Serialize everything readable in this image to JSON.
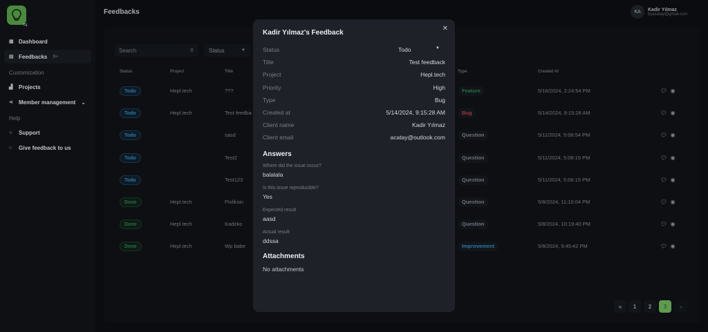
{
  "sidebar": {
    "items": [
      {
        "label": "Dashboard",
        "icon": "grid-icon"
      },
      {
        "label": "Feedbacks",
        "icon": "inbox-icon",
        "badge": "9+"
      },
      {
        "label": "Projects",
        "icon": "chart-icon"
      },
      {
        "label": "Member management",
        "icon": "share-icon"
      },
      {
        "label": "Support",
        "icon": "headset-icon"
      },
      {
        "label": "Give feedback to us",
        "icon": "lightbulb-icon"
      }
    ],
    "sections": [
      "Customization",
      "Help"
    ]
  },
  "header": {
    "title": "Feedbacks",
    "user": {
      "initials": "KA",
      "name": "Kadir Yılmaz",
      "email": "byacatay@gmail.com"
    }
  },
  "filters": {
    "search_placeholder": "Search",
    "status_label": "Status"
  },
  "table": {
    "columns": [
      "Status",
      "Project",
      "Title",
      "Type",
      "Created At"
    ],
    "rows": [
      {
        "status": "Todo",
        "project": "Hepl.tech",
        "title": "???",
        "type": "Feature",
        "created": "5/16/2024, 2:24:54 PM"
      },
      {
        "status": "Todo",
        "project": "Hepl.tech",
        "title": "Test feedba",
        "type": "Bug",
        "created": "5/14/2024, 9:15:28 AM"
      },
      {
        "status": "Todo",
        "project": "",
        "title": "sasd",
        "type": "Question",
        "created": "5/11/2024, 5:08:54 PM"
      },
      {
        "status": "Todo",
        "project": "",
        "title": "Test2",
        "type": "Question",
        "created": "5/11/2024, 5:08:15 PM"
      },
      {
        "status": "Todo",
        "project": "",
        "title": "Test123",
        "type": "Question",
        "created": "5/11/2024, 5:06:15 PM"
      },
      {
        "status": "Done",
        "project": "Hepl.tech",
        "title": "Pisliksin",
        "type": "Question",
        "created": "5/8/2024, 11:10:04 PM"
      },
      {
        "status": "Done",
        "project": "Hepl.tech",
        "title": "Kadirko",
        "type": "Question",
        "created": "5/8/2024, 10:19:40 PM"
      },
      {
        "status": "Done",
        "project": "Hepl.tech",
        "title": "Wp babe",
        "type": "Improvement",
        "created": "5/8/2024, 9:49:42 PM"
      }
    ]
  },
  "pagination": {
    "prev": "«",
    "pages": [
      "1",
      "2",
      "3"
    ],
    "current": "3",
    "next": "»"
  },
  "modal": {
    "title": "Kadir Yılmaz's Feedback",
    "fields": [
      {
        "k": "Status",
        "v": "Todo"
      },
      {
        "k": "Title",
        "v": "Test feedback"
      },
      {
        "k": "Project",
        "v": "Hepl.tech"
      },
      {
        "k": "Priority",
        "v": "High"
      },
      {
        "k": "Type",
        "v": "Bug"
      },
      {
        "k": "Created at",
        "v": "5/14/2024, 9:15:28 AM"
      },
      {
        "k": "Client name",
        "v": "Kadir Yılmaz"
      },
      {
        "k": "Client email",
        "v": "acatay@outlook.com"
      }
    ],
    "answers_title": "Answers",
    "answers": [
      {
        "q": "Where did the issue occur?",
        "a": "balalala"
      },
      {
        "q": "Is this issue reproducible?",
        "a": "Yes"
      },
      {
        "q": "Expected result",
        "a": "aasd"
      },
      {
        "q": "Actual result",
        "a": "ddssa"
      }
    ],
    "attachments_title": "Attachments",
    "attachments_empty": "No attachments"
  },
  "colors": {
    "accent": "#5d9c50",
    "todo": "#2a78a8",
    "done": "#267045",
    "feature": "#267045",
    "bug": "#a8323e",
    "question": "#6f737a",
    "improvement": "#2a78a8"
  }
}
